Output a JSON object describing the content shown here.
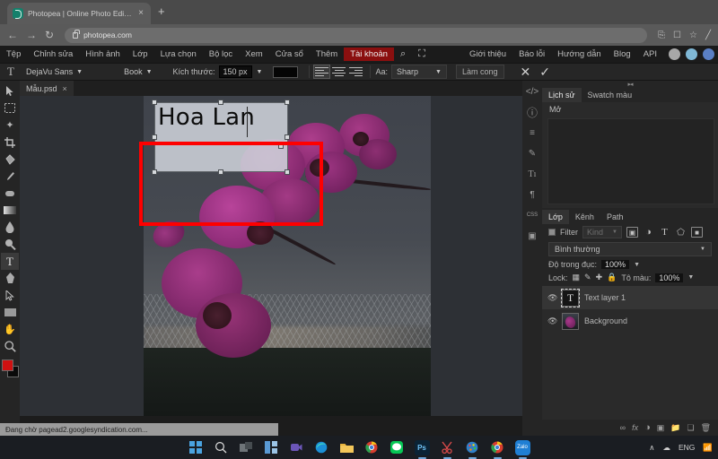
{
  "browser": {
    "tab_title": "Photopea | Online Photo Editor",
    "tab_close": "×",
    "new_tab": "+",
    "back": "←",
    "forward": "→",
    "reload": "↻",
    "url": "photopea.com",
    "toolbar_icons": [
      "install-icon",
      "page-icon",
      "bookmark-star-icon",
      "pen-icon"
    ]
  },
  "photopea": {
    "menus": [
      "Tệp",
      "Chỉnh sửa",
      "Hình ảnh",
      "Lớp",
      "Lựa chọn",
      "Bộ lọc",
      "Xem",
      "Cửa sổ",
      "Thêm"
    ],
    "account_menu": "Tài khoản",
    "search_icon": "⌕",
    "fullscreen_icon": "⛶",
    "right_links": [
      "Giới thiệu",
      "Báo lỗi",
      "Hướng dẫn",
      "Blog",
      "API"
    ],
    "social": [
      "reddit-icon",
      "twitter-icon",
      "facebook-icon"
    ],
    "options": {
      "tool_icon": "T",
      "font_family": "DejaVu Sans",
      "font_style": "Book",
      "size_label": "Kích thước:",
      "size_value": "150 px",
      "color_swatch": "#050505",
      "aa_label": "Aa:",
      "aa_value": "Sharp",
      "warp_button": "Làm cong",
      "cancel": "✕",
      "confirm": "✓",
      "caret": "▼"
    },
    "document_tab": {
      "name": "Mẫu.psd",
      "close": "×"
    },
    "tools": [
      "move-tool",
      "marquee-select-tool",
      "magic-wand-tool",
      "crop-tool",
      "paint-bucket-tool",
      "brush-tool",
      "eraser-tool",
      "gradient-tool",
      "blur-tool",
      "dodge-tool",
      "text-tool",
      "pen-tool",
      "path-select-tool",
      "shape-tool",
      "hand-tool",
      "zoom-tool"
    ],
    "active_tool": "text-tool",
    "foreground_color": "#cf1111",
    "background_color": "#0a0a0a",
    "canvas": {
      "text_layer_content": "Hoa Lan",
      "image_subject": "purple orchid flowers at dusk with chain-link fence"
    },
    "annotation": {
      "type": "red-rectangle-highlight",
      "color": "#fe0000"
    },
    "right_rail": [
      "code-icon",
      "info-icon",
      "lines-icon",
      "brush-icon",
      "type-icon",
      "paragraph-icon",
      "css-icon",
      "image-icon"
    ],
    "history_panel": {
      "tabs": [
        "Lịch sử",
        "Swatch màu"
      ],
      "active_tab": "Lịch sử",
      "entries": [
        "Mở"
      ]
    },
    "layers_panel": {
      "tabs": [
        "Lớp",
        "Kênh",
        "Path"
      ],
      "active_tab": "Lớp",
      "filter_label": "Filter",
      "filter_kind": "Kind",
      "filter_icons": [
        "image-filter-icon",
        "adjustment-filter-icon",
        "type-filter-icon",
        "shape-filter-icon",
        "smart-object-filter-icon"
      ],
      "blend_mode": "Bình thường",
      "opacity_label": "Độ trong đục:",
      "opacity_value": "100%",
      "lock_label": "Lock:",
      "lock_icons": [
        "lock-transparency-icon",
        "lock-paint-icon",
        "lock-position-icon",
        "lock-all-icon"
      ],
      "fill_label": "Tô màu:",
      "fill_value": "100%",
      "caret": "▼",
      "layers": [
        {
          "name": "Text layer 1",
          "type": "text",
          "visible": true,
          "selected": true
        },
        {
          "name": "Background",
          "type": "image",
          "visible": true,
          "selected": false
        }
      ],
      "footer_icons": [
        "link-icon",
        "fx-icon",
        "adjustment-icon",
        "mask-icon",
        "folder-icon",
        "new-layer-icon",
        "trash-icon"
      ]
    },
    "status_text": "Đang chờ pagead2.googlesyndication.com..."
  },
  "taskbar": {
    "items": [
      "start-icon",
      "search-icon",
      "task-view-icon",
      "widgets-icon",
      "teams-icon",
      "edge-icon",
      "file-explorer-icon",
      "chrome-icon",
      "line-icon",
      "photoshop-icon",
      "snipping-tool-icon",
      "paint-icon",
      "chrome-active-icon",
      "zalo-icon"
    ],
    "photoshop_label": "Ps",
    "zalo_label": "Zalo",
    "tray": {
      "chevron": "∧",
      "cloud_icon": "onedrive-icon",
      "language": "ENG",
      "network_icon": "wifi-icon"
    }
  }
}
